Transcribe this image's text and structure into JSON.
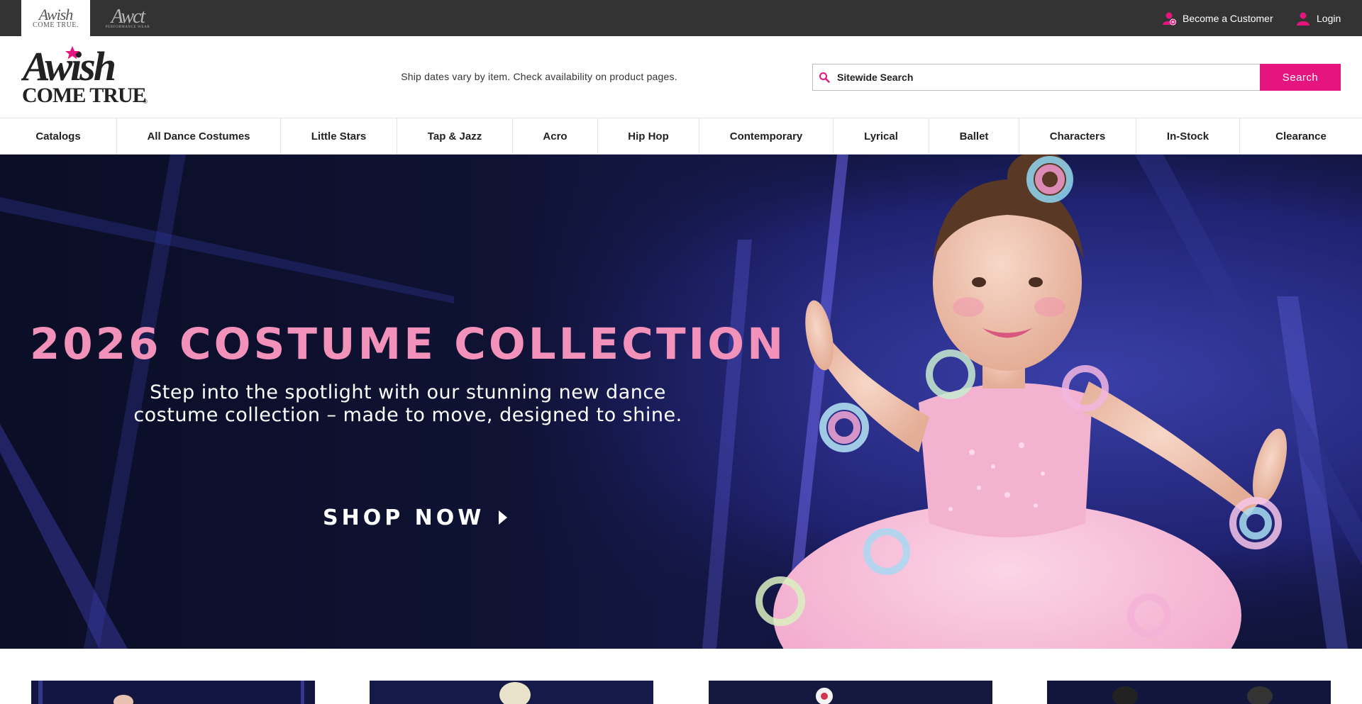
{
  "brand_tabs": [
    {
      "name": "awish-come-true",
      "line1": "Awish",
      "line2": "COME TRUE."
    },
    {
      "name": "awct-performance-wear",
      "line1": "Awct",
      "line2": "PERFORMANCE WEAR"
    }
  ],
  "utility": {
    "become_customer": "Become a Customer",
    "login": "Login"
  },
  "header": {
    "ship_note": "Ship dates vary by item. Check availability on product pages.",
    "search_placeholder": "Sitewide Search",
    "search_button": "Search"
  },
  "nav": {
    "items": [
      "Catalogs",
      "All Dance Costumes",
      "Little Stars",
      "Tap & Jazz",
      "Acro",
      "Hip Hop",
      "Contemporary",
      "Lyrical",
      "Ballet",
      "Characters",
      "In-Stock",
      "Clearance"
    ]
  },
  "hero": {
    "title": "2026 COSTUME COLLECTION",
    "subtitle": "Step into the spotlight with our stunning new dance\ncostume collection – made to move, designed to shine.",
    "cta": "SHOP NOW"
  },
  "colors": {
    "topbar": "#333333",
    "accent": "#e6147e",
    "hero_title": "#f291b9",
    "hero_bg": "#0f1230"
  },
  "icons": {
    "customer": "add-user-icon",
    "login": "user-icon",
    "search": "search-icon",
    "cta": "play-arrow-icon"
  }
}
